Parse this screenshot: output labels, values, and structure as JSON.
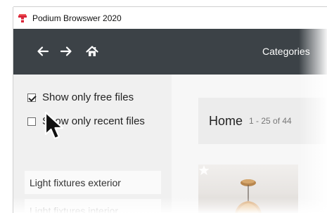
{
  "window": {
    "title": "Podium Browswer 2020",
    "app_icon": "podium-logo-icon"
  },
  "navbar": {
    "back_icon": "arrow-left-icon",
    "forward_icon": "arrow-right-icon",
    "home_icon": "home-icon",
    "categories_label": "Categories"
  },
  "filters": {
    "free_label": "Show only free files",
    "free_checked": true,
    "recent_label": "Show only recent files",
    "recent_checked": false
  },
  "categories": [
    {
      "label": "Light fixtures exterior"
    },
    {
      "label": "Light fixtures interior"
    }
  ],
  "main": {
    "title": "Home",
    "range": "1 - 25 of 44"
  },
  "colors": {
    "navbar_bg": "#3c4247",
    "sidebar_bg": "#f0f0f0",
    "brand_red": "#d9263a"
  }
}
